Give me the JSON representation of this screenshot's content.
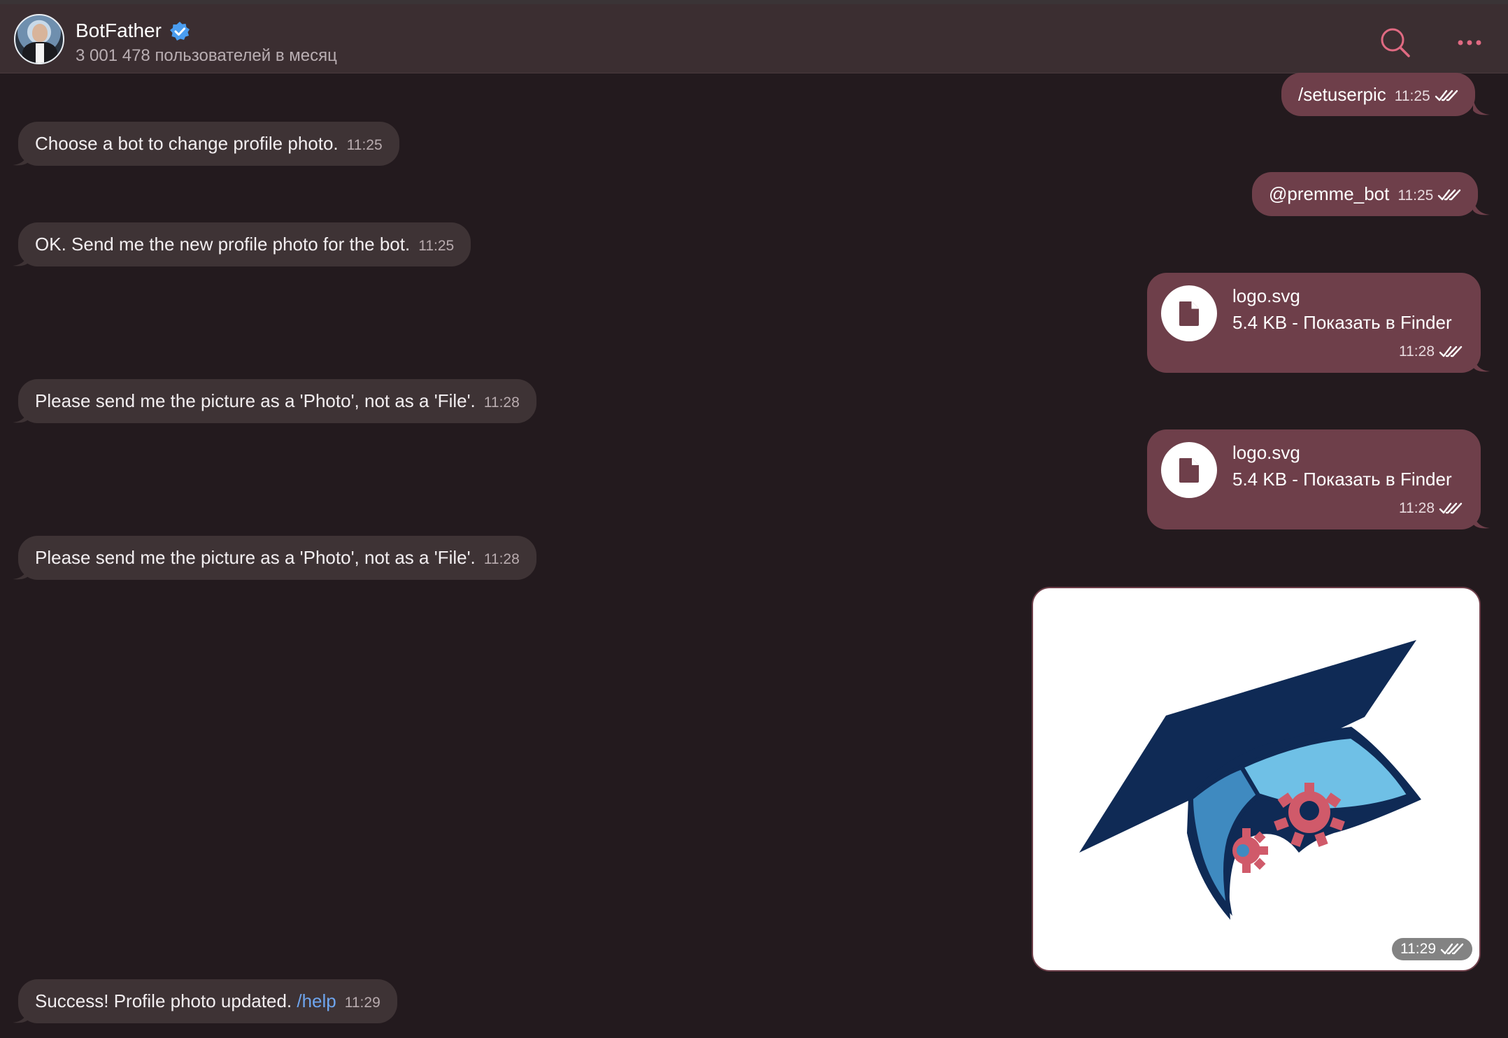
{
  "header": {
    "name": "BotFather",
    "subtitle": "3 001 478 пользователей в месяц",
    "verified_icon": "verified-badge-icon",
    "search_icon": "search-icon",
    "more_icon": "more-dots-icon"
  },
  "messages": [
    {
      "dir": "out",
      "text": "/setuserpic",
      "time": "11:25"
    },
    {
      "dir": "in",
      "text": "Choose a bot to change profile photo.",
      "time": "11:25"
    },
    {
      "dir": "out",
      "text": "@premme_bot",
      "time": "11:25"
    },
    {
      "dir": "in",
      "text": "OK. Send me the new profile photo for the bot.",
      "time": "11:25"
    },
    {
      "dir": "out",
      "type": "file",
      "file_name": "logo.svg",
      "file_meta": "5.4 KB - Показать в Finder",
      "time": "11:28"
    },
    {
      "dir": "in",
      "text": "Please send me the picture as a 'Photo', not as a 'File'.",
      "time": "11:28"
    },
    {
      "dir": "out",
      "type": "file",
      "file_name": "logo.svg",
      "file_meta": "5.4 KB - Показать в Finder",
      "time": "11:28"
    },
    {
      "dir": "in",
      "text": "Please send me the picture as a 'Photo', not as a 'File'.",
      "time": "11:28"
    },
    {
      "dir": "out",
      "type": "photo",
      "image": "graduation-cap-gears-logo",
      "time": "11:29"
    },
    {
      "dir": "in",
      "text": "Success! Profile photo updated.",
      "link": "/help",
      "time": "11:29"
    }
  ],
  "colors": {
    "background": "#231a1e",
    "header": "#3b2e31",
    "incoming_bubble": "#3e3335",
    "outgoing_bubble": "#6e3f4a",
    "accent": "#e0607a",
    "link": "#6ea5ee",
    "logo_navy": "#0f2a55",
    "logo_light_blue": "#6fc0e6",
    "logo_mid_blue": "#3f8ac0",
    "logo_gear": "#d05a6a"
  }
}
